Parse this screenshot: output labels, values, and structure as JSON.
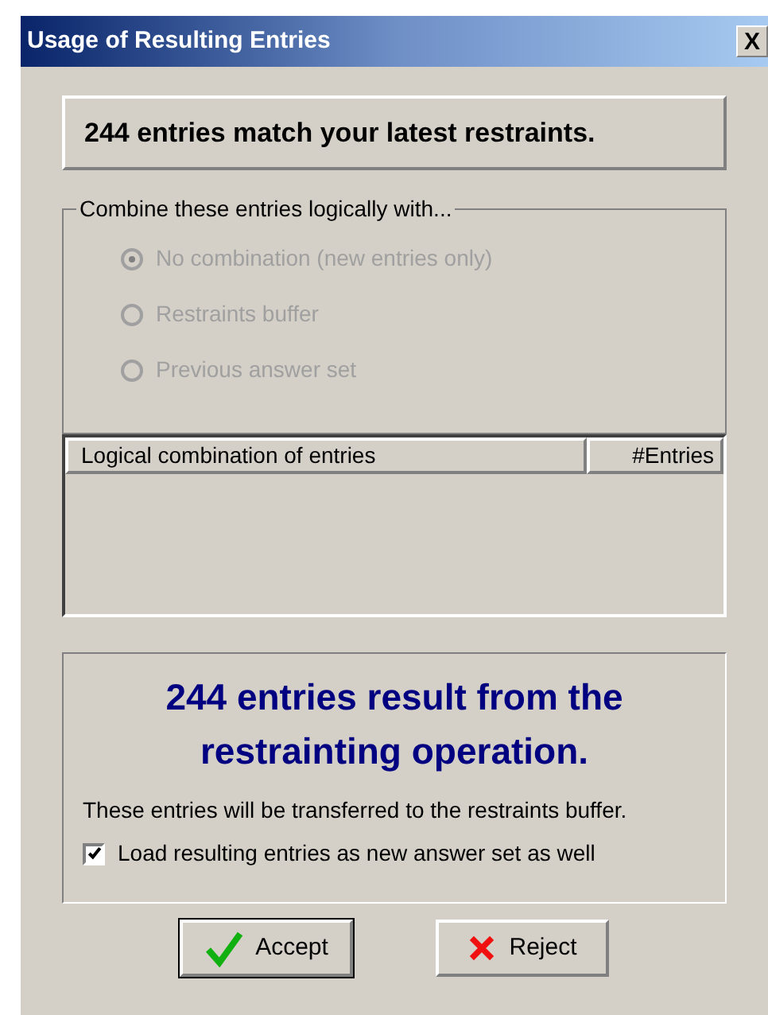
{
  "window": {
    "title": "Usage of Resulting Entries",
    "close": "X"
  },
  "match_message": "244 entries match your latest restraints.",
  "combine_group": {
    "label": "Combine these entries logically with...",
    "disabled": true,
    "options": [
      {
        "label": "No combination (new entries only)",
        "selected": true
      },
      {
        "label": "Restraints buffer",
        "selected": false
      },
      {
        "label": "Previous answer set",
        "selected": false
      }
    ]
  },
  "table": {
    "columns": [
      "Logical combination of entries",
      "#Entries"
    ]
  },
  "result": {
    "headline": "244 entries result from the restrainting operation.",
    "note": "These entries will be transferred to the restraints buffer.",
    "checkbox": {
      "label": "Load resulting entries as new answer set as well",
      "checked": true
    }
  },
  "buttons": [
    {
      "label": "Accept",
      "kind": "accept",
      "default": true
    },
    {
      "label": "Reject",
      "kind": "reject",
      "default": false
    }
  ]
}
